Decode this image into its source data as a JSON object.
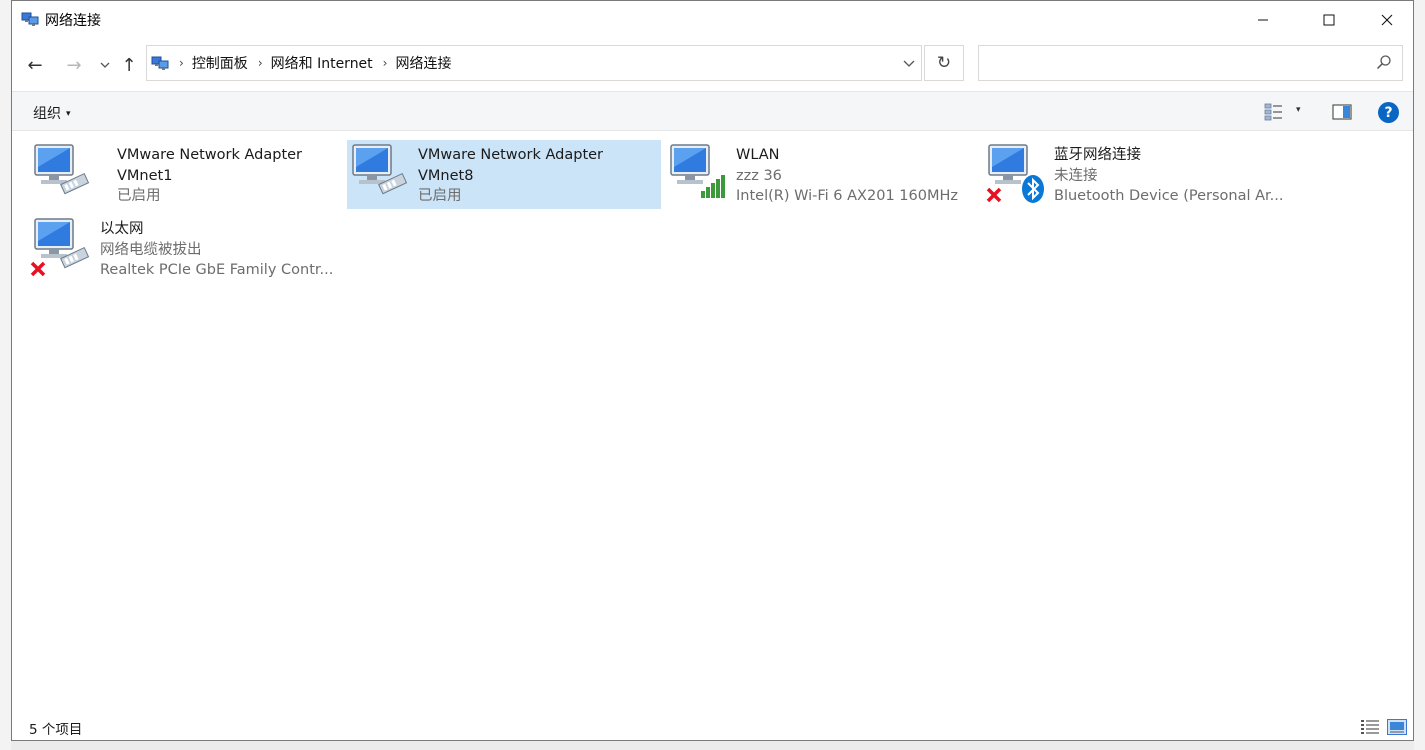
{
  "window": {
    "title": "网络连接",
    "minimize_label": "—",
    "maximize_label": "☐",
    "close_label": "✕"
  },
  "nav": {
    "back": "←",
    "forward": "→",
    "recent": "⌄",
    "up": "↑",
    "refresh": "↻",
    "breadcrumb": [
      "控制面板",
      "网络和 Internet",
      "网络连接"
    ],
    "breadcrumb_separator": "›",
    "search_placeholder": "",
    "address_dropdown": "⌄"
  },
  "toolbar": {
    "organize": "组织",
    "organize_caret": "▾",
    "view_caret": "▾",
    "help": "?"
  },
  "connections": [
    {
      "name": "VMware Network Adapter",
      "line2": "VMnet1",
      "line3": "已启用",
      "icon": "ethernet-adapter-icon",
      "selected": false,
      "state_badge": null
    },
    {
      "name": "VMware Network Adapter",
      "line2": "VMnet8",
      "line3": "已启用",
      "icon": "ethernet-adapter-icon",
      "selected": true,
      "state_badge": null
    },
    {
      "name": "WLAN",
      "line2": "zzz 36",
      "line3": "Intel(R) Wi-Fi 6 AX201 160MHz",
      "icon": "wifi-adapter-icon",
      "selected": false,
      "state_badge": "signal-bars"
    },
    {
      "name": "蓝牙网络连接",
      "line2": "未连接",
      "line3": "Bluetooth Device (Personal Ar...",
      "icon": "bluetooth-adapter-icon",
      "selected": false,
      "state_badge": "disconnected"
    },
    {
      "name": "以太网",
      "line2": "网络电缆被拔出",
      "line3": "Realtek PCIe GbE Family Contr...",
      "icon": "ethernet-adapter-icon",
      "selected": false,
      "state_badge": "disconnected"
    }
  ],
  "status": {
    "item_count": "5 个项目"
  },
  "colors": {
    "selection": "#cce4f7",
    "accent": "#0a66c2",
    "error": "#e81123",
    "signal": "#3c9a3c",
    "bluetooth": "#0a78d7"
  }
}
